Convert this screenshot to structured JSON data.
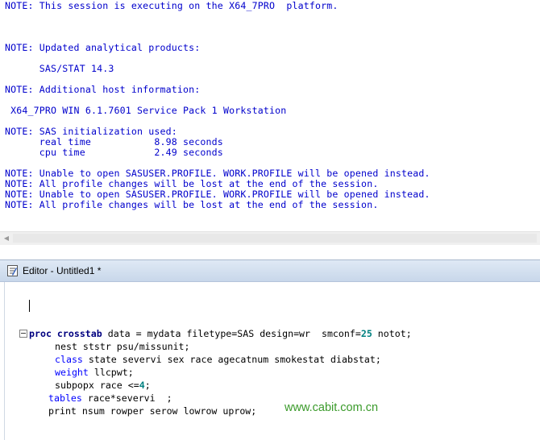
{
  "log": {
    "lines": [
      "NOTE: This session is executing on the X64_7PRO  platform.",
      "NOTE: Updated analytical products:",
      "      SAS/STAT 14.3",
      "NOTE: Additional host information:",
      " X64_7PRO WIN 6.1.7601 Service Pack 1 Workstation",
      "NOTE: SAS initialization used:",
      "      real time           8.98 seconds",
      "      cpu time            2.49 seconds",
      "NOTE: Unable to open SASUSER.PROFILE. WORK.PROFILE will be opened instead.",
      "NOTE: All profile changes will be lost at the end of the session.",
      "NOTE: Unable to open SASUSER.PROFILE. WORK.PROFILE will be opened instead.",
      "NOTE: All profile changes will be lost at the end of the session."
    ]
  },
  "editor": {
    "title": "Editor - Untitled1 *",
    "code": {
      "l1_kw": "proc crosstab",
      "l1_a": " data = mydata filetype=SAS design=wr  smconf=",
      "l1_num": "25",
      "l1_b": " notot;",
      "l2": "nest ststr psu/missunit;",
      "l3_kw": "class",
      "l3_rest": " state severvi sex race agecatnum smokestat diabstat;",
      "l4_kw": "weight",
      "l4_rest": " llcpwt;",
      "l5_a": "subpopx race <=",
      "l5_num": "4",
      "l5_b": ";",
      "l6_kw": "tables",
      "l6_rest": " race*severvi  ;",
      "l7": "print nsum rowper serow lowrow uprow;"
    }
  },
  "watermark": "www.cabit.com.cn",
  "colors": {
    "log_text": "#0000cc",
    "keyword": "#000080",
    "option": "#0000ff",
    "number": "#008080",
    "watermark": "#3a9a2a"
  }
}
